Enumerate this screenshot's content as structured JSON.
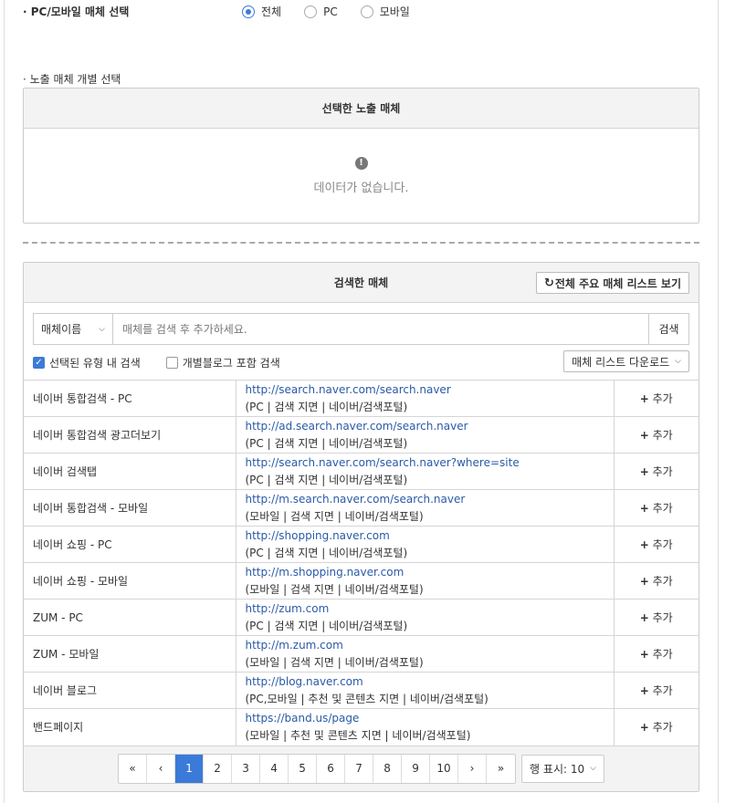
{
  "media_type": {
    "title": "· PC/모바일 매체 선택",
    "options": [
      {
        "label": "전체",
        "checked": true
      },
      {
        "label": "PC",
        "checked": false
      },
      {
        "label": "모바일",
        "checked": false
      }
    ]
  },
  "individual": {
    "title": "· 노출 매체 개별 선택",
    "selected_header": "선택한 노출 매체",
    "empty_text": "데이터가 없습니다."
  },
  "search_panel": {
    "header": "검색한 매체",
    "list_button": "전체 주요 매체 리스트 보기",
    "select_value": "매체이름",
    "input_placeholder": "매체를 검색 후 추가하세요.",
    "search_button": "검색",
    "filter_selected_type": "선택된 유형 내 검색",
    "filter_include_blog": "개별블로그 포함 검색",
    "download_button": "매체 리스트 다운로드",
    "add_label": "추가",
    "rows": [
      {
        "name": "네이버 통합검색 - PC",
        "url": "http://search.naver.com/search.naver",
        "meta": "(PC | 검색 지면 | 네이버/검색포털)"
      },
      {
        "name": "네이버 통합검색 광고더보기",
        "url": "http://ad.search.naver.com/search.naver",
        "meta": "(PC | 검색 지면 | 네이버/검색포털)"
      },
      {
        "name": "네이버 검색탭",
        "url": "http://search.naver.com/search.naver?where=site",
        "meta": "(PC | 검색 지면 | 네이버/검색포털)"
      },
      {
        "name": "네이버 통합검색 - 모바일",
        "url": "http://m.search.naver.com/search.naver",
        "meta": "(모바일 | 검색 지면 | 네이버/검색포털)"
      },
      {
        "name": "네이버 쇼핑 - PC",
        "url": "http://shopping.naver.com",
        "meta": "(PC | 검색 지면 | 네이버/검색포털)"
      },
      {
        "name": "네이버 쇼핑 - 모바일",
        "url": "http://m.shopping.naver.com",
        "meta": "(모바일 | 검색 지면 | 네이버/검색포털)"
      },
      {
        "name": "ZUM - PC",
        "url": "http://zum.com",
        "meta": "(PC | 검색 지면 | 네이버/검색포털)"
      },
      {
        "name": "ZUM - 모바일",
        "url": "http://m.zum.com",
        "meta": "(모바일 | 검색 지면 | 네이버/검색포털)"
      },
      {
        "name": "네이버 블로그",
        "url": "http://blog.naver.com",
        "meta": "(PC,모바일 | 추천 및 콘텐츠 지면 | 네이버/검색포털)"
      },
      {
        "name": "밴드페이지",
        "url": "https://band.us/page",
        "meta": "(모바일 | 추천 및 콘텐츠 지면 | 네이버/검색포털)"
      }
    ]
  },
  "pagination": {
    "first": "«",
    "prev": "‹",
    "pages": [
      "1",
      "2",
      "3",
      "4",
      "5",
      "6",
      "7",
      "8",
      "9",
      "10"
    ],
    "active": "1",
    "next": "›",
    "last": "»",
    "rows_label": "행 표시: 10"
  }
}
